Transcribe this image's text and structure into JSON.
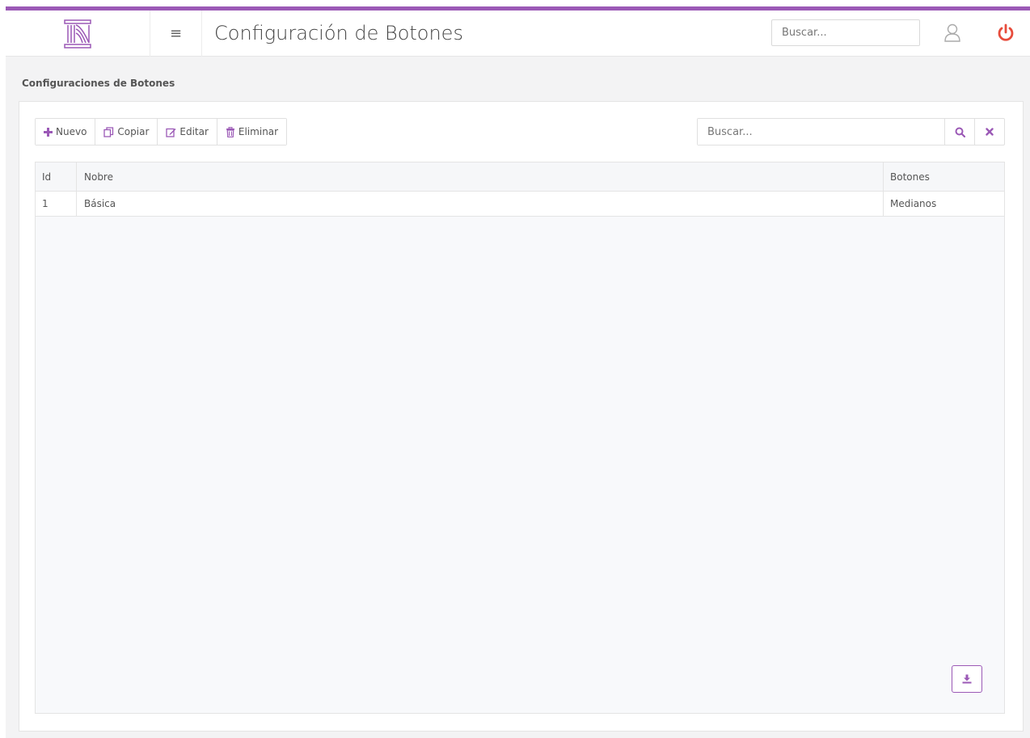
{
  "header": {
    "title": "Configuración de Botones",
    "search_placeholder": "Buscar...",
    "logo_icon": "column-logo-icon",
    "menu_icon": "hamburger-icon",
    "user_icon": "user-icon",
    "power_icon": "power-icon"
  },
  "colors": {
    "accent": "#9b59b6",
    "power": "#e74c3c"
  },
  "section": {
    "title": "Configuraciones de Botones"
  },
  "toolbar": {
    "new_label": "Nuevo",
    "copy_label": "Copiar",
    "edit_label": "Editar",
    "delete_label": "Eliminar"
  },
  "grid_search": {
    "placeholder": "Buscar...",
    "search_icon": "search-icon",
    "clear_icon": "close-icon"
  },
  "table": {
    "columns": [
      "Id",
      "Nobre",
      "Botones"
    ],
    "rows": [
      {
        "id": "1",
        "name": "Básica",
        "buttons": "Medianos"
      }
    ]
  },
  "footer": {
    "export_icon": "download-icon"
  }
}
